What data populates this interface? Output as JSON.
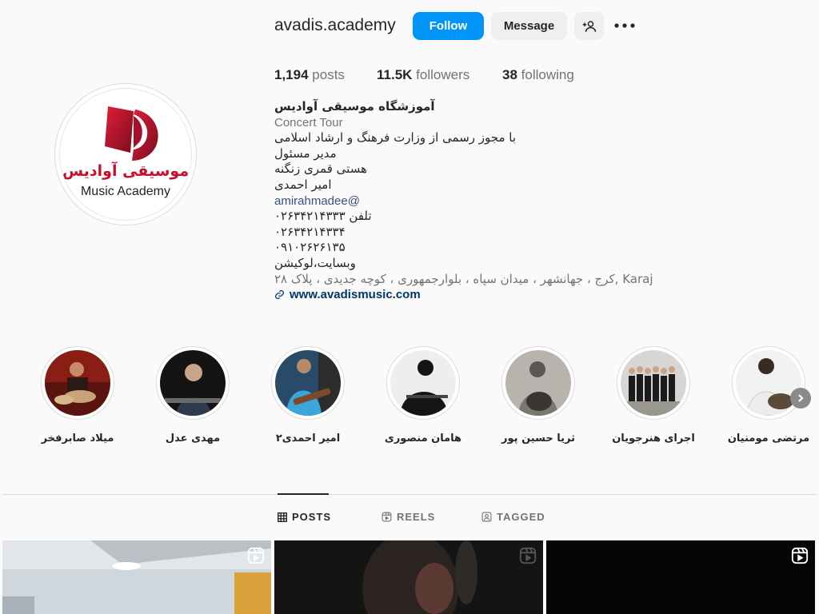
{
  "profile": {
    "username": "avadis.academy",
    "follow_label": "Follow",
    "message_label": "Message",
    "stats": {
      "posts_count": "1,194",
      "posts_label": "posts",
      "followers_count": "11.5K",
      "followers_label": "followers",
      "following_count": "38",
      "following_label": "following"
    },
    "logo": {
      "text_fa": "موسیقی آوادیس",
      "text_en": "Music Academy"
    },
    "bio": {
      "title": "آموزشگاه موسیقی آوادیس",
      "category": "Concert Tour",
      "lines": [
        "با مجوز رسمی از وزارت فرهنگ و ارشاد اسلامی",
        "مدیر مسئول",
        "هستی قمری زنگنه",
        "امیر احمدی"
      ],
      "mention": "amirahmadee@",
      "phones": [
        "تلفن ۰۲۶۳۴۲۱۴۳۳۳",
        "۰۲۶۳۴۲۱۴۳۳۴",
        "۰۹۱۰۲۶۲۶۱۳۵"
      ],
      "website_location": "وبسایت،لوکیشن",
      "address": "کرج ، جهانشهر ، میدان سپاه ، بلوارجمهوری ، کوچه جدیدی ، پلاک ۲۸, Karaj",
      "link": "www.avadismusic.com"
    }
  },
  "highlights": [
    {
      "label": "میلاد صابرفخر"
    },
    {
      "label": "مهدی عدل"
    },
    {
      "label": "امیر احمدی۲"
    },
    {
      "label": "هامان منصوری"
    },
    {
      "label": "ثریا حسین پور"
    },
    {
      "label": "اجرای هنرجویان"
    },
    {
      "label": "مرتضی مومنیان"
    }
  ],
  "tabs": [
    {
      "label": "POSTS",
      "icon": "grid-icon",
      "active": true
    },
    {
      "label": "REELS",
      "icon": "reels-icon",
      "active": false
    },
    {
      "label": "TAGGED",
      "icon": "tagged-icon",
      "active": false
    }
  ],
  "colors": {
    "accent": "#0095f6",
    "brand_red": "#c8102e",
    "link": "#00376b"
  }
}
